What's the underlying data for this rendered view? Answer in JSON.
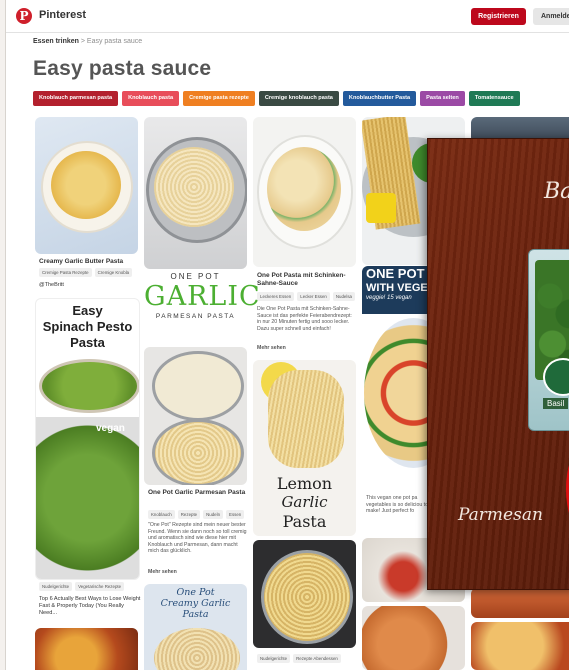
{
  "header": {
    "brand": "Pinterest",
    "register": "Registrieren",
    "login": "Anmelden"
  },
  "breadcrumb": {
    "parent": "Essen trinken",
    "separator": " > ",
    "current": "Easy pasta sauce"
  },
  "page_title": "Easy pasta sauce",
  "chips": [
    {
      "label": "Knoblauch parmesan pasta",
      "color": "#b3202d"
    },
    {
      "label": "Knoblauch pasta",
      "color": "#e84d5a"
    },
    {
      "label": "Cremige pasta rezepte",
      "color": "#ef7f21"
    },
    {
      "label": "Cremige knoblauch pasta",
      "color": "#3a4a43"
    },
    {
      "label": "Knoblauchbutter Pasta",
      "color": "#235a9c"
    },
    {
      "label": "Pasta selten",
      "color": "#9b4aa5"
    },
    {
      "label": "Tomatensauce",
      "color": "#1f7a55"
    }
  ],
  "pins": {
    "p1": {
      "title": "Creamy Garlic Butter Pasta",
      "tags": [
        "Cremige Pasta Rezepte",
        "Cremige Knobla"
      ],
      "by": "TheBritt"
    },
    "p2": {
      "img": [
        "Easy",
        "Spinach Pesto",
        "Pasta"
      ],
      "img2": "vegan",
      "tags": [
        "Nudelgerichte",
        "Vegetarische Rezepte"
      ],
      "title": "Top 6 Actually Best Ways to Lose Weight Fast & Properly Today (You Really Need..."
    },
    "p3": {
      "img": [
        "ONE POT",
        "GARLIC",
        "PARMESAN PASTA"
      ],
      "title": "One Pot Garlic Parmesan Pasta",
      "tags": [
        "Knoblauch",
        "Rezepte",
        "Nudeln",
        "Essen"
      ],
      "desc": "\"One Pot\" Rezepte sind mein neuer bester Freund. Wenn sie dann noch so toll cremig und aromatisch sind wie diese hier mit Knoblauch und Parmesan, dann macht mich das glücklich.",
      "more": "Mehr sehen"
    },
    "p3b": {
      "img": [
        "One Pot",
        "Creamy Garlic",
        "Pasta"
      ]
    },
    "p4": {
      "title": "One Pot Pasta mit Schinken-Sahne-Sauce",
      "tags": [
        "Leckeres Essen",
        "Lecker Essen",
        "Nudelsa"
      ],
      "desc": "Die One Pot Pasta mit Schinken-Sahne-Sauce ist das perfekte Feierabendrezept: in nur 20 Minuten fertig und sooo lecker. Dazu super schnell und einfach!",
      "more": "Mehr sehen"
    },
    "p4b": {
      "img": [
        "Lemon",
        "Garlic",
        "Pasta"
      ],
      "tags": [
        "Nudelgerichte",
        "Rezepte Abendessen"
      ]
    },
    "p5": {
      "img": [
        "ONE POT PA",
        "WITH VEGE",
        "veggie! 15 vegan"
      ],
      "desc": "This vegan one pot pa vegetables is so deliciou to make! Just perfect fo"
    }
  },
  "overlay": {
    "script_top": "Ba",
    "script_bottom": "Parmesan",
    "pack_label": "Basil"
  }
}
